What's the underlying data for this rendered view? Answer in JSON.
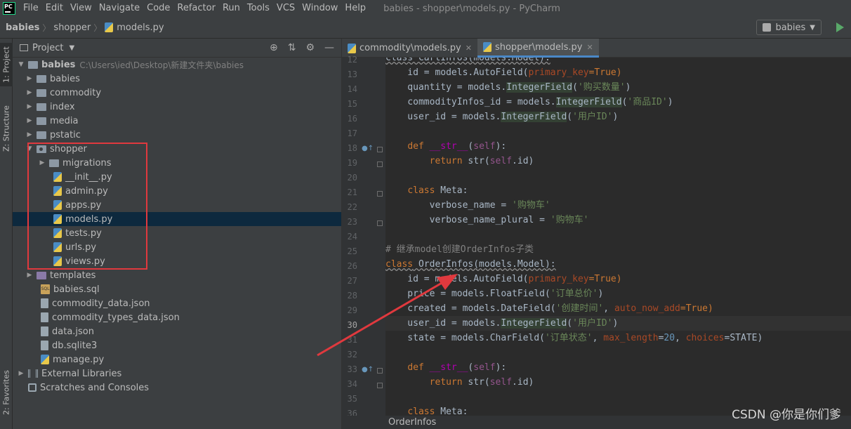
{
  "menubar": {
    "logo": "PC",
    "items": [
      "File",
      "Edit",
      "View",
      "Navigate",
      "Code",
      "Refactor",
      "Run",
      "Tools",
      "VCS",
      "Window",
      "Help"
    ],
    "window_title": "babies - shopper\\models.py - PyCharm"
  },
  "navbar": {
    "crumbs": [
      "babies",
      "shopper",
      "models.py"
    ],
    "run_config": "babies"
  },
  "left_strip": {
    "project_tab": "1: Project",
    "structure_tab": "Z: Structure",
    "favorites_tab": "2: Favorites"
  },
  "project": {
    "header": "Project",
    "root_name": "babies",
    "root_path": "C:\\Users\\ied\\Desktop\\新建文件夹\\babies",
    "items": [
      {
        "label": "babies"
      },
      {
        "label": "commodity"
      },
      {
        "label": "index"
      },
      {
        "label": "media"
      },
      {
        "label": "pstatic"
      },
      {
        "label": "shopper"
      },
      {
        "label": "migrations"
      },
      {
        "label": "__init__.py"
      },
      {
        "label": "admin.py"
      },
      {
        "label": "apps.py"
      },
      {
        "label": "models.py"
      },
      {
        "label": "tests.py"
      },
      {
        "label": "urls.py"
      },
      {
        "label": "views.py"
      },
      {
        "label": "templates"
      },
      {
        "label": "babies.sql"
      },
      {
        "label": "commodity_data.json"
      },
      {
        "label": "commodity_types_data.json"
      },
      {
        "label": "data.json"
      },
      {
        "label": "db.sqlite3"
      },
      {
        "label": "manage.py"
      },
      {
        "label": "External Libraries"
      },
      {
        "label": "Scratches and Consoles"
      }
    ]
  },
  "editor": {
    "tabs": [
      {
        "label": "commodity\\models.py",
        "active": false
      },
      {
        "label": "shopper\\models.py",
        "active": true
      }
    ],
    "current_line": 30,
    "code_breadcrumb": "OrderInfos",
    "line_numbers": [
      "12",
      "13",
      "14",
      "15",
      "16",
      "17",
      "18",
      "19",
      "20",
      "21",
      "22",
      "23",
      "24",
      "25",
      "26",
      "27",
      "28",
      "29",
      "30",
      "31",
      "32",
      "33",
      "34",
      "35",
      "36"
    ],
    "lines": {
      "l12": "class CartInfos(models.Model):",
      "l13a": "    id = models.AutoField(",
      "l13b": "primary_key",
      "l13c": "=True)",
      "l14a": "    quantity = models.",
      "l14b": "IntegerField",
      "l14c": "(",
      "l14d": "'购买数量'",
      "l14e": ")",
      "l15a": "    commodityInfos_id = models.",
      "l15b": "IntegerField",
      "l15c": "(",
      "l15d": "'商品ID'",
      "l15e": ")",
      "l16a": "    user_id = models.",
      "l16b": "IntegerField",
      "l16c": "(",
      "l16d": "'用户ID'",
      "l16e": ")",
      "l18a": "    ",
      "l18b": "def",
      "l18c": " __str__",
      "l18d": "(",
      "l18e": "self",
      "l18f": "):",
      "l19a": "        ",
      "l19b": "return",
      "l19c": " str(",
      "l19d": "self",
      "l19e": ".id)",
      "l21a": "    ",
      "l21b": "class",
      "l21c": " Meta:",
      "l22a": "        verbose_name = ",
      "l22b": "'购物车'",
      "l23a": "        verbose_name_plural = ",
      "l23b": "'购物车'",
      "l25": "# 继承model创建OrderInfos子类",
      "l26a": "class",
      "l26b": " OrderInfos(models.Model):",
      "l27a": "    id = models.AutoField(",
      "l27b": "primary_key",
      "l27c": "=True)",
      "l28a": "    price = models.FloatField(",
      "l28b": "'订单总价'",
      "l28c": ")",
      "l29a": "    created = models.DateField(",
      "l29b": "'创建时间'",
      "l29c": ", ",
      "l29d": "auto_now_add",
      "l29e": "=True)",
      "l30a": "    user_id = models.",
      "l30b": "IntegerField",
      "l30c": "(",
      "l30d": "'用户ID'",
      "l30e": ")",
      "l31a": "    state = models.CharField(",
      "l31b": "'订单状态'",
      "l31c": ", ",
      "l31d": "max_length",
      "l31e": "=",
      "l31f": "20",
      "l31g": ", ",
      "l31h": "choices",
      "l31i": "=STATE)",
      "l33a": "    ",
      "l33b": "def",
      "l33c": " __str__",
      "l33d": "(",
      "l33e": "self",
      "l33f": "):",
      "l34a": "        ",
      "l34b": "return",
      "l34c": " str(",
      "l34d": "self",
      "l34e": ".id)",
      "l36a": "    ",
      "l36b": "class",
      "l36c": " Meta:"
    }
  },
  "watermark": "CSDN @你是你们爹",
  "colors": {
    "annotation_red": "#e0393e",
    "selection": "#0d293e",
    "accent_tab": "#4a88c7",
    "run_green": "#59a869"
  }
}
